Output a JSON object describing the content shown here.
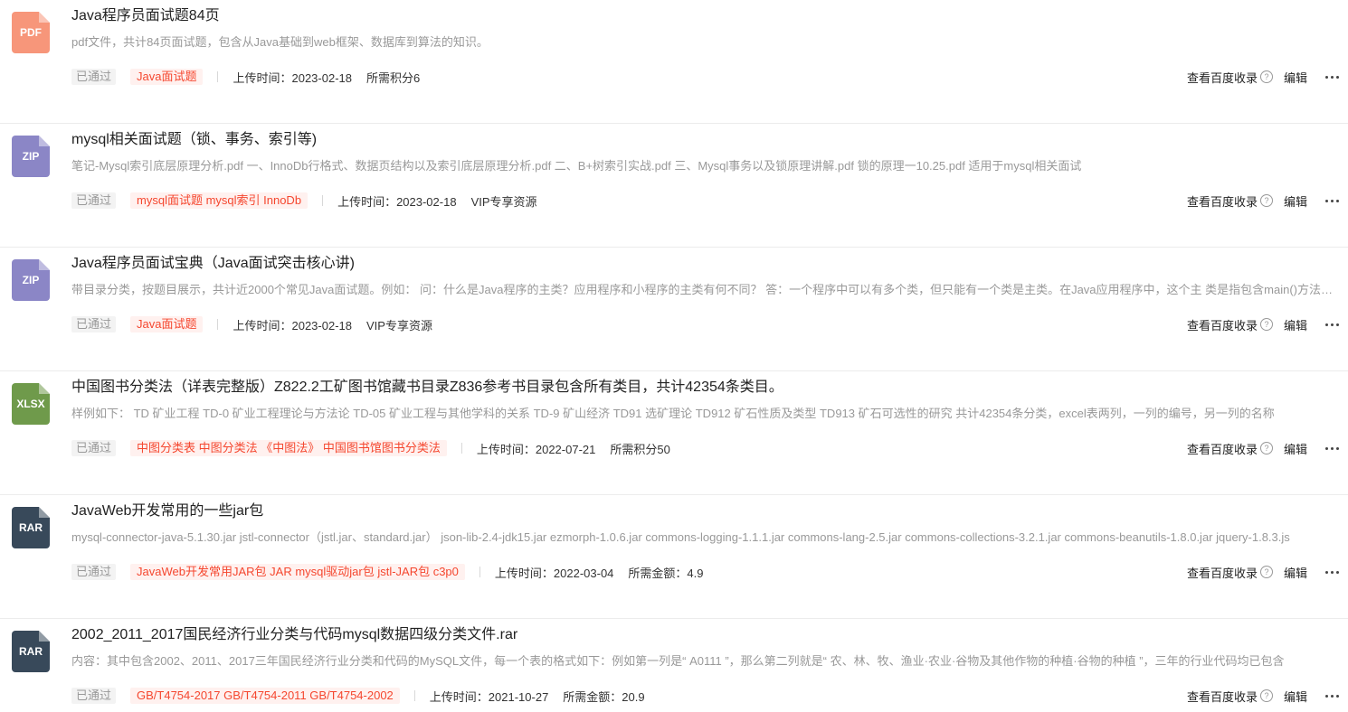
{
  "actions": {
    "baidu_label": "查看百度收录",
    "help_glyph": "?",
    "edit_label": "编辑"
  },
  "items": [
    {
      "icon": "PDF",
      "icon_color": "#f7967a",
      "title": "Java程序员面试题84页",
      "desc": "pdf文件，共计84页面试题，包含从Java基础到web框架、数据库到算法的知识。",
      "status": "已通过",
      "tags": "Java面试题",
      "upload": "上传时间：2023-02-18",
      "price": "所需积分6"
    },
    {
      "icon": "ZIP",
      "icon_color": "#8b86c6",
      "title": "mysql相关面试题（锁、事务、索引等)",
      "desc": "笔记-Mysql索引底层原理分析.pdf 一、InnoDb行格式、数据页结构以及索引底层原理分析.pdf 二、B+树索引实战.pdf 三、Mysql事务以及锁原理讲解.pdf 锁的原理一10.25.pdf 适用于mysql相关面试",
      "status": "已通过",
      "tags": "mysql面试题 mysql索引 InnoDb",
      "upload": "上传时间：2023-02-18",
      "price": "VIP专享资源"
    },
    {
      "icon": "ZIP",
      "icon_color": "#8b86c6",
      "title": "Java程序员面试宝典（Java面试突击核心讲)",
      "desc": "带目录分类，按题目展示，共计近2000个常见Java面试题。例如： 问：什么是Java程序的主类？应用程序和小程序的主类有何不同？ 答：一个程序中可以有多个类，但只能有一个类是主类。在Java应用程序中，这个主 类是指包含main()方法的类",
      "status": "已通过",
      "tags": "Java面试题",
      "upload": "上传时间：2023-02-18",
      "price": "VIP专享资源"
    },
    {
      "icon": "XLSX",
      "icon_color": "#6f9a4b",
      "title": "中国图书分类法（详表完整版）Z822.2工矿图书馆藏书目录Z836参考书目录包含所有类目，共计42354条类目。",
      "desc": "样例如下： TD 矿业工程 TD-0 矿业工程理论与方法论 TD-05 矿业工程与其他学科的关系 TD-9 矿山经济 TD91 选矿理论 TD912 矿石性质及类型 TD913 矿石可选性的研究 共计42354条分类，excel表两列，一列的编号，另一列的名称",
      "status": "已通过",
      "tags": "中图分类表 中图分类法 《中图法》 中国图书馆图书分类法",
      "upload": "上传时间：2022-07-21",
      "price": "所需积分50"
    },
    {
      "icon": "RAR",
      "icon_color": "#38495a",
      "title": "JavaWeb开发常用的一些jar包",
      "desc": "mysql-connector-java-5.1.30.jar jstl-connector（jstl.jar、standard.jar） json-lib-2.4-jdk15.jar ezmorph-1.0.6.jar commons-logging-1.1.1.jar commons-lang-2.5.jar commons-collections-3.2.1.jar commons-beanutils-1.8.0.jar jquery-1.8.3.js",
      "status": "已通过",
      "tags": "JavaWeb开发常用JAR包 JAR mysql驱动jar包 jstl-JAR包 c3p0",
      "upload": "上传时间：2022-03-04",
      "price": "所需金额：4.9"
    },
    {
      "icon": "RAR",
      "icon_color": "#38495a",
      "title": "2002_2011_2017国民经济行业分类与代码mysql数据四级分类文件.rar",
      "desc": "内容：其中包含2002、2011、2017三年国民经济行业分类和代码的MySQL文件，每一个表的格式如下：例如第一列是“ A0111 ”，那么第二列就是“ 农、林、牧、渔业·农业·谷物及其他作物的种植·谷物的种植 ”，三年的行业代码均已包含",
      "status": "已通过",
      "tags": "GB/T4754-2017 GB/T4754-2011 GB/T4754-2002",
      "upload": "上传时间：2021-10-27",
      "price": "所需金额：20.9"
    }
  ]
}
